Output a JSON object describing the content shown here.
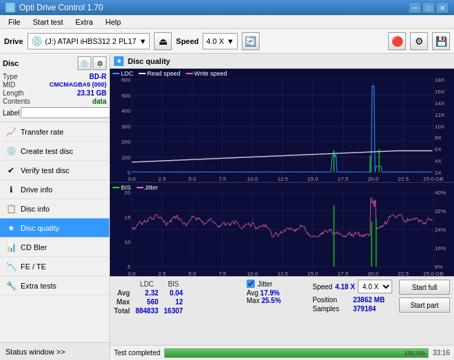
{
  "titleBar": {
    "title": "Opti Drive Control 1.70",
    "icon": "⬡",
    "controls": [
      "─",
      "□",
      "✕"
    ]
  },
  "menuBar": {
    "items": [
      "File",
      "Start test",
      "Extra",
      "Help"
    ]
  },
  "toolbar": {
    "driveLabel": "Drive",
    "driveValue": "(J:) ATAPI iHBS312  2 PL17",
    "speedLabel": "Speed",
    "speedValue": "4.0 X"
  },
  "discInfo": {
    "title": "Disc",
    "fields": [
      {
        "label": "Type",
        "value": "BD-R"
      },
      {
        "label": "MID",
        "value": "CMCMAGBA5 (000)"
      },
      {
        "label": "Length",
        "value": "23.31 GB"
      },
      {
        "label": "Contents",
        "value": "data"
      },
      {
        "label": "Label",
        "value": ""
      }
    ]
  },
  "navItems": [
    {
      "id": "transfer-rate",
      "label": "Transfer rate",
      "icon": "📈"
    },
    {
      "id": "create-test-disc",
      "label": "Create test disc",
      "icon": "💿"
    },
    {
      "id": "verify-test-disc",
      "label": "Verify test disc",
      "icon": "✔"
    },
    {
      "id": "drive-info",
      "label": "Drive info",
      "icon": "ℹ"
    },
    {
      "id": "disc-info",
      "label": "Disc info",
      "icon": "📋"
    },
    {
      "id": "disc-quality",
      "label": "Disc quality",
      "icon": "★",
      "active": true
    },
    {
      "id": "cd-bler",
      "label": "CD Bler",
      "icon": "📊"
    },
    {
      "id": "fe-te",
      "label": "FE / TE",
      "icon": "📉"
    },
    {
      "id": "extra-tests",
      "label": "Extra tests",
      "icon": "🔧"
    }
  ],
  "statusWindow": "Status window >>",
  "chartHeader": {
    "title": "Disc quality"
  },
  "upperChart": {
    "legend": [
      {
        "label": "LDC",
        "color": "#3399ff"
      },
      {
        "label": "Read speed",
        "color": "#ffffff"
      },
      {
        "label": "Write speed",
        "color": "#ff69b4"
      }
    ],
    "yAxisLeft": [
      "600",
      "500",
      "400",
      "300",
      "200",
      "100",
      "0"
    ],
    "yAxisRight": [
      "18X",
      "16X",
      "14X",
      "12X",
      "10X",
      "8X",
      "6X",
      "4X",
      "2X"
    ],
    "xAxis": [
      "0.0",
      "2.5",
      "5.0",
      "7.5",
      "10.0",
      "12.5",
      "15.0",
      "17.5",
      "20.0",
      "22.5",
      "25.0 GB"
    ]
  },
  "lowerChart": {
    "legend": [
      {
        "label": "BIS",
        "color": "#00ff00"
      },
      {
        "label": "Jitter",
        "color": "#ff69b4"
      }
    ],
    "yAxisLeft": [
      "20",
      "15",
      "10",
      "5"
    ],
    "yAxisRight": [
      "40%",
      "32%",
      "24%",
      "16%",
      "8%"
    ],
    "xAxis": [
      "0.0",
      "2.5",
      "5.0",
      "7.5",
      "10.0",
      "12.5",
      "15.0",
      "17.5",
      "20.0",
      "22.5",
      "25.0 GB"
    ]
  },
  "stats": {
    "headers": [
      "",
      "LDC",
      "BIS"
    ],
    "rows": [
      {
        "label": "Avg",
        "ldc": "2.32",
        "bis": "0.04"
      },
      {
        "label": "Max",
        "ldc": "560",
        "bis": "12"
      },
      {
        "label": "Total",
        "ldc": "884833",
        "bis": "16307"
      }
    ],
    "jitter": {
      "label": "Jitter",
      "avg": "17.9%",
      "max": "25.5%"
    },
    "speed": {
      "label": "Speed",
      "value": "4.18 X",
      "selectValue": "4.0 X"
    },
    "position": {
      "label": "Position",
      "value": "23862 MB"
    },
    "samples": {
      "label": "Samples",
      "value": "379184"
    },
    "buttons": {
      "startFull": "Start full",
      "startPart": "Start part"
    }
  },
  "progressBar": {
    "statusText": "Test completed",
    "percent": 100,
    "percentLabel": "100.0%",
    "timeText": "33:16"
  }
}
